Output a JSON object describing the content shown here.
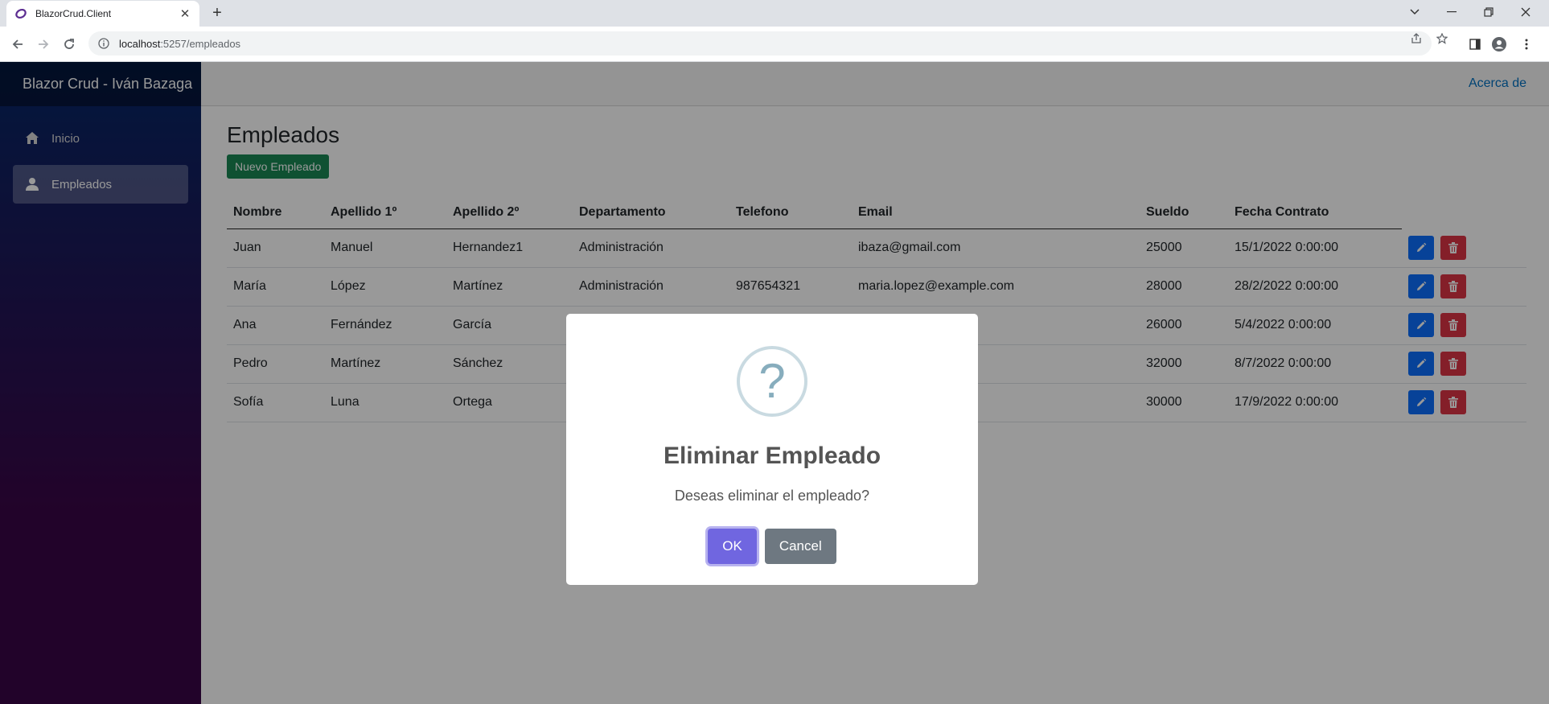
{
  "browser": {
    "tab_title": "BlazorCrud.Client",
    "url_host": "localhost",
    "url_path": ":5257/empleados"
  },
  "sidebar": {
    "brand": "Blazor Crud - Iván Bazaga",
    "items": [
      {
        "label": "Inicio",
        "icon": "home-icon",
        "active": false
      },
      {
        "label": "Empleados",
        "icon": "person-icon",
        "active": true
      }
    ]
  },
  "header": {
    "about": "Acerca de"
  },
  "main": {
    "title": "Empleados",
    "new_button": "Nuevo Empleado",
    "columns": [
      "Nombre",
      "Apellido 1º",
      "Apellido 2º",
      "Departamento",
      "Telefono",
      "Email",
      "Sueldo",
      "Fecha Contrato"
    ],
    "rows": [
      {
        "nombre": "Juan",
        "apellido1": "Manuel",
        "apellido2": "Hernandez1",
        "departamento": "Administración",
        "telefono": "",
        "email": "ibaza@gmail.com",
        "sueldo": "25000",
        "fecha": "15/1/2022 0:00:00"
      },
      {
        "nombre": "María",
        "apellido1": "López",
        "apellido2": "Martínez",
        "departamento": "Administración",
        "telefono": "987654321",
        "email": "maria.lopez@example.com",
        "sueldo": "28000",
        "fecha": "28/2/2022 0:00:00"
      },
      {
        "nombre": "Ana",
        "apellido1": "Fernández",
        "apellido2": "García",
        "departamento": "",
        "telefono": "",
        "email": "ple.com",
        "sueldo": "26000",
        "fecha": "5/4/2022 0:00:00"
      },
      {
        "nombre": "Pedro",
        "apellido1": "Martínez",
        "apellido2": "Sánchez",
        "departamento": "",
        "telefono": "",
        "email": "mple.com",
        "sueldo": "32000",
        "fecha": "8/7/2022 0:00:00"
      },
      {
        "nombre": "Sofía",
        "apellido1": "Luna",
        "apellido2": "Ortega",
        "departamento": "",
        "telefono": "",
        "email": "com",
        "sueldo": "30000",
        "fecha": "17/9/2022 0:00:00"
      }
    ]
  },
  "dialog": {
    "icon": "question-icon",
    "title": "Eliminar Empleado",
    "text": "Deseas eliminar el empleado?",
    "ok": "OK",
    "cancel": "Cancel"
  },
  "colors": {
    "primary": "#0d6efd",
    "danger": "#dc3545",
    "success": "#198754",
    "confirm": "#7066e0",
    "cancel": "#6e7881"
  }
}
